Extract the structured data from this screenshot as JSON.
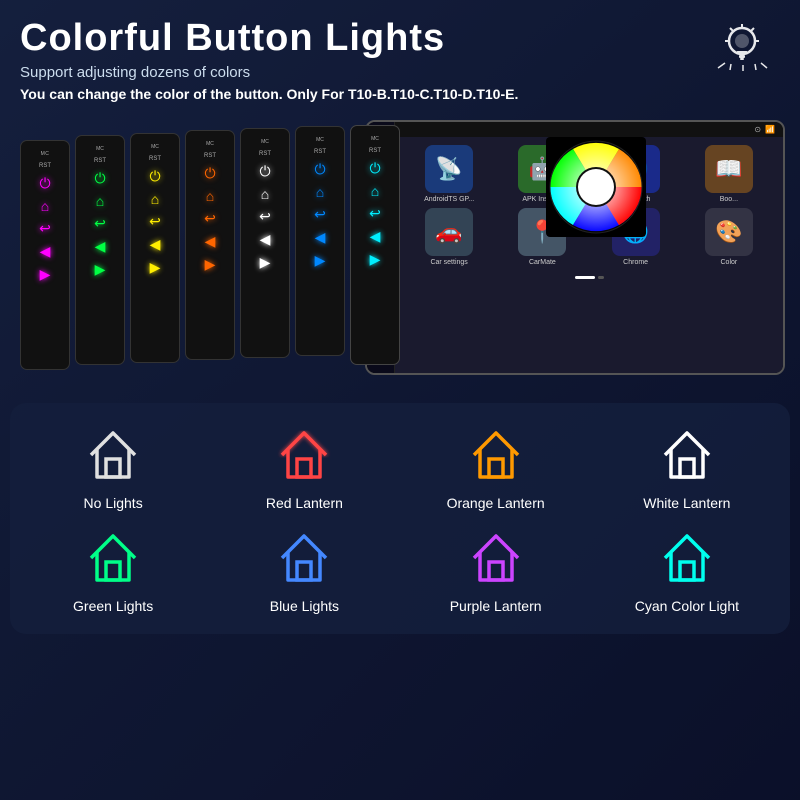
{
  "header": {
    "title": "Colorful Button Lights",
    "subtitle": "Support adjusting dozens of colors",
    "note": "You can change the color of the button.  Only For T10-B.T10-C.T10-D.T10-E."
  },
  "devices": [
    {
      "label": "MC",
      "buttons": [
        "⏻",
        "⌂",
        "↩",
        "⇦",
        "⟨",
        "⟩"
      ],
      "colors": [
        "#ff00ff",
        "#ff00ff",
        "#ff00ff",
        "#ff00ff",
        "#ff00ff",
        "#ff00ff"
      ]
    },
    {
      "label": "MC",
      "buttons": [
        "⏻",
        "⌂",
        "↩",
        "⇦",
        "⟨",
        "⟩"
      ],
      "colors": [
        "#00ff00",
        "#00ff00",
        "#00ff00",
        "#00ff00",
        "#00ff00",
        "#00ff00"
      ]
    },
    {
      "label": "MC",
      "buttons": [
        "⏻",
        "⌂",
        "↩",
        "⇦",
        "⟨",
        "⟩"
      ],
      "colors": [
        "#ffff00",
        "#ffff00",
        "#ffff00",
        "#ffff00",
        "#ffff00",
        "#ffff00"
      ]
    },
    {
      "label": "MC",
      "buttons": [
        "⏻",
        "⌂",
        "↩",
        "⇦",
        "⟨",
        "⟩"
      ],
      "colors": [
        "#ff4400",
        "#ff4400",
        "#ff4400",
        "#ff4400",
        "#ff4400",
        "#ff4400"
      ]
    },
    {
      "label": "MC",
      "buttons": [
        "⏻",
        "⌂",
        "↩",
        "⇦",
        "⟨",
        "⟩"
      ],
      "colors": [
        "#ffffff",
        "#ffffff",
        "#ffffff",
        "#ffffff",
        "#ffffff",
        "#ffffff"
      ]
    },
    {
      "label": "MC",
      "buttons": [
        "⏻",
        "⌂",
        "↩",
        "⇦",
        "⟨",
        "⟩"
      ],
      "colors": [
        "#0088ff",
        "#0088ff",
        "#0088ff",
        "#0088ff",
        "#0088ff",
        "#0088ff"
      ]
    },
    {
      "label": "MC",
      "buttons": [
        "⏻",
        "⌂",
        "↩",
        "⇦",
        "⟨",
        "⟩"
      ],
      "colors": [
        "#00ccff",
        "#00ccff",
        "#00ccff",
        "#00ccff",
        "#00ccff",
        "#00ccff"
      ]
    }
  ],
  "apps": [
    {
      "label": "AndroidTS GP...",
      "bg": "#2244aa",
      "icon": "📡"
    },
    {
      "label": "APK Install...",
      "bg": "#44aa44",
      "icon": "🤖"
    },
    {
      "label": "Bluetooth",
      "bg": "#3355cc",
      "icon": "🔵"
    },
    {
      "label": "Boo...",
      "bg": "#884422",
      "icon": "📖"
    },
    {
      "label": "Car settings",
      "bg": "#334455",
      "icon": "🚗"
    },
    {
      "label": "CarMate",
      "bg": "#556677",
      "icon": "📍"
    },
    {
      "label": "Chrome",
      "bg": "#222266",
      "icon": "🌐"
    },
    {
      "label": "Color",
      "bg": "#333344",
      "icon": "🎨"
    }
  ],
  "lights": [
    {
      "label": "No Lights",
      "class": "house-white"
    },
    {
      "label": "Red Lantern",
      "class": "house-red"
    },
    {
      "label": "Orange Lantern",
      "class": "house-orange"
    },
    {
      "label": "White Lantern",
      "class": "house-white-glow"
    },
    {
      "label": "Green Lights",
      "class": "house-green"
    },
    {
      "label": "Blue Lights",
      "class": "house-blue"
    },
    {
      "label": "Purple Lantern",
      "class": "house-purple"
    },
    {
      "label": "Cyan Color Light",
      "class": "house-cyan"
    }
  ]
}
